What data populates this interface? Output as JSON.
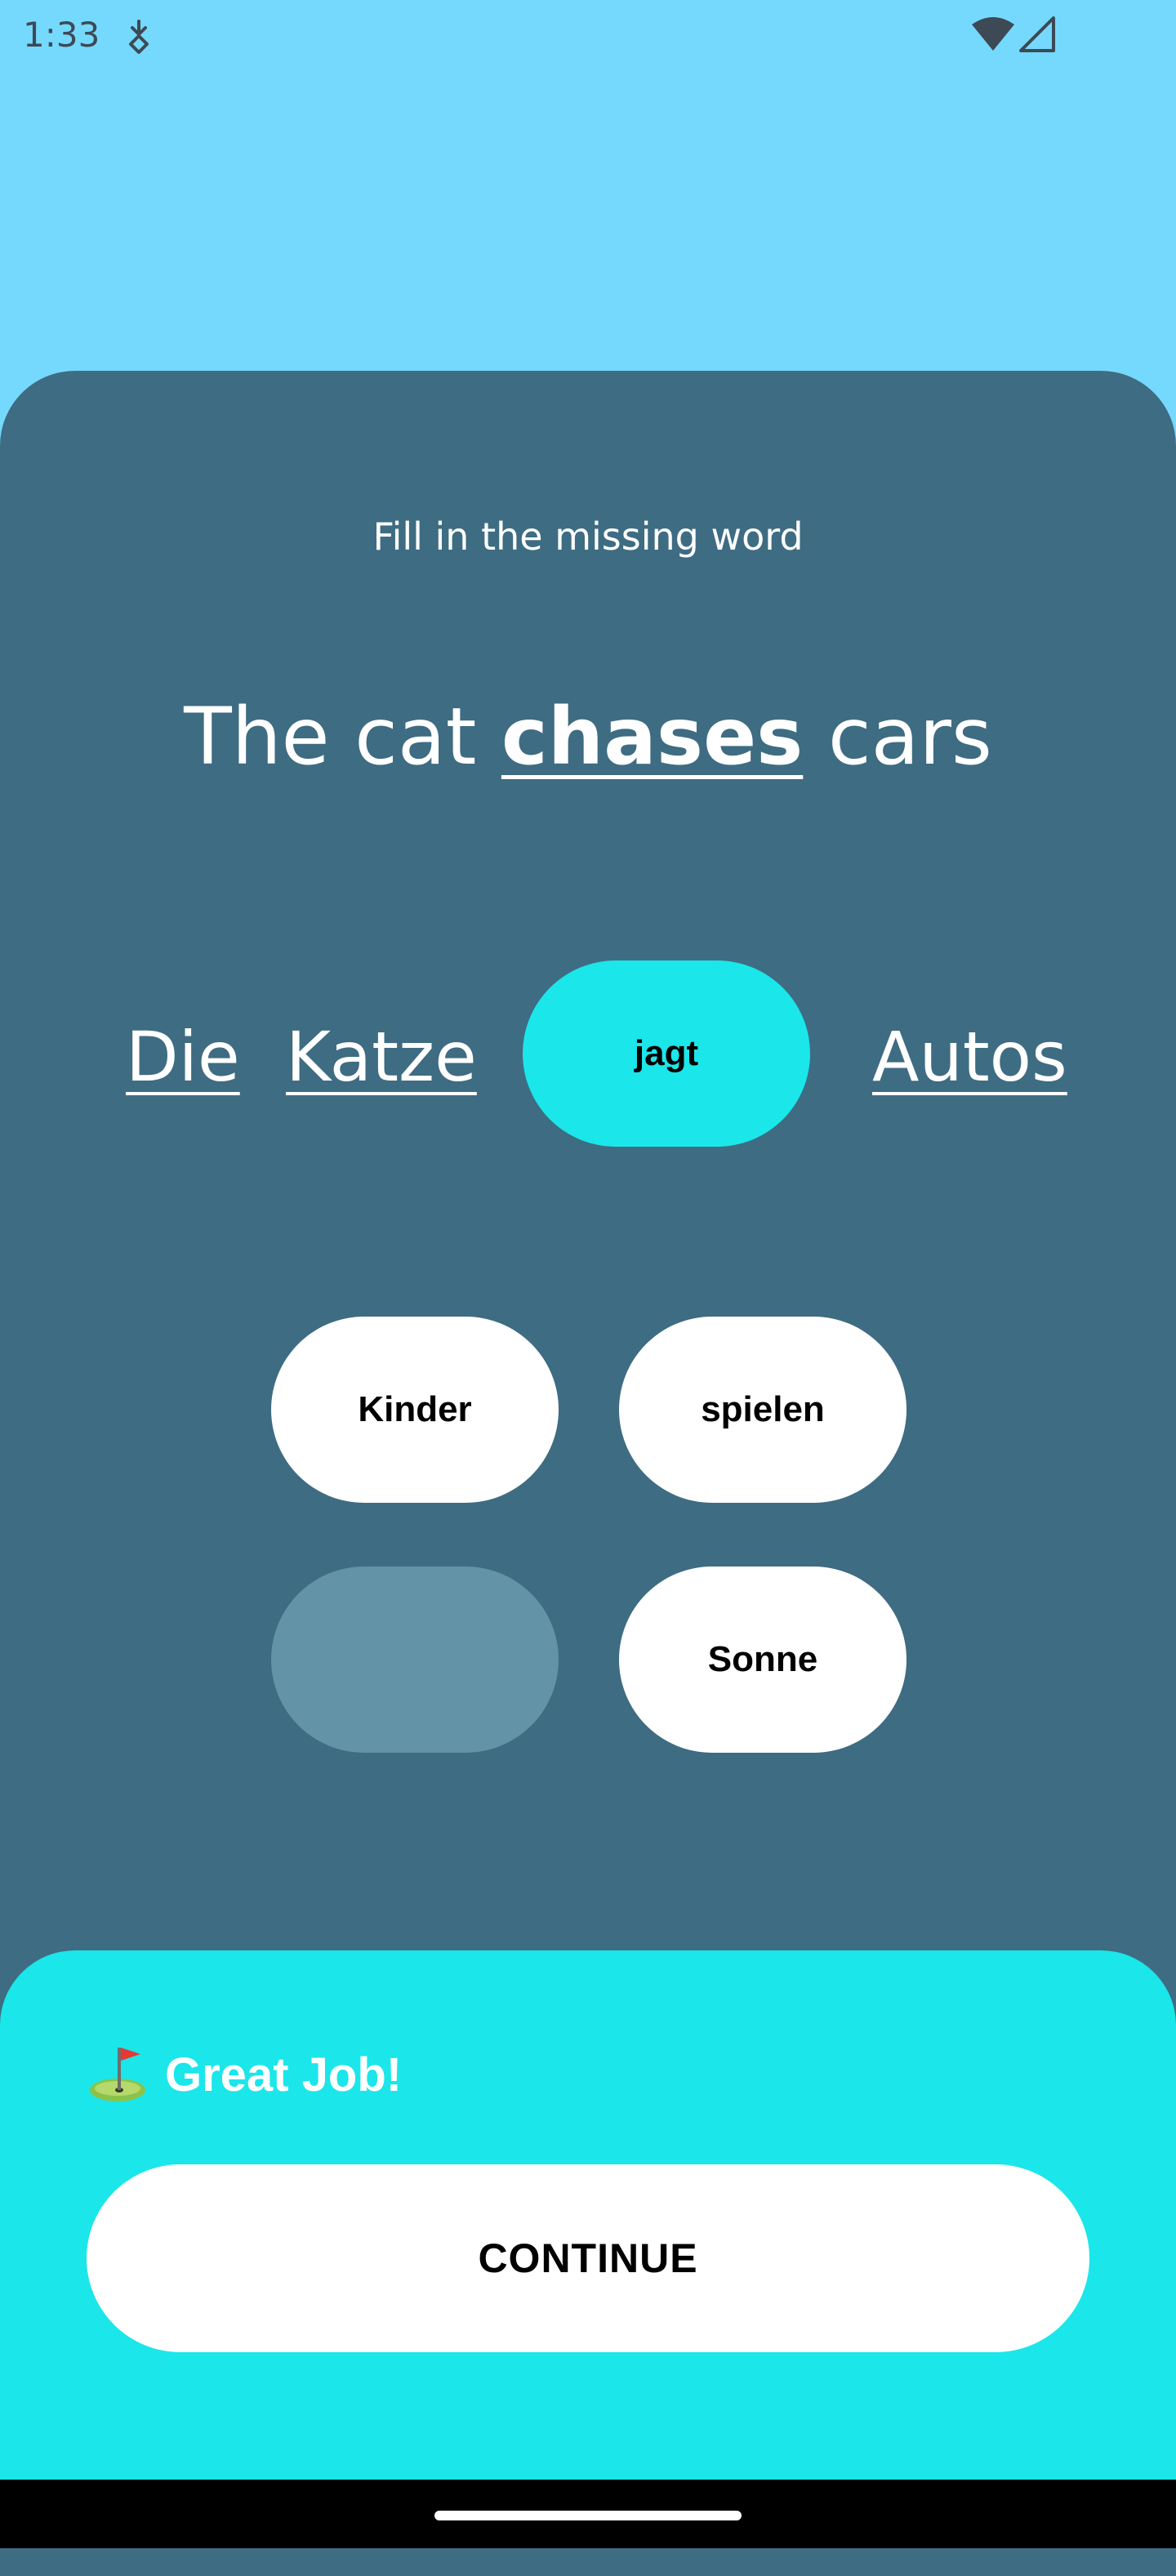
{
  "status_bar": {
    "time": "1:33",
    "icons": [
      "download-notification-icon",
      "wifi-icon",
      "signal-icon"
    ]
  },
  "exercise": {
    "instruction": "Fill in the missing word",
    "sentence": {
      "before": "The cat ",
      "highlight": "chases",
      "after": " cars"
    },
    "target_words": [
      "Die",
      "Katze",
      "jagt",
      "Autos"
    ],
    "selected_word": "jagt",
    "options": [
      "Kinder",
      "spielen",
      "",
      "Sonne"
    ]
  },
  "feedback": {
    "emoji": "golf-flag-icon",
    "message": "Great Job!",
    "continue_label": "CONTINUE"
  },
  "colors": {
    "background": "#75d9fd",
    "card": "#3e6c82",
    "accent": "#1be6ea",
    "used_option": "#6393a7"
  }
}
